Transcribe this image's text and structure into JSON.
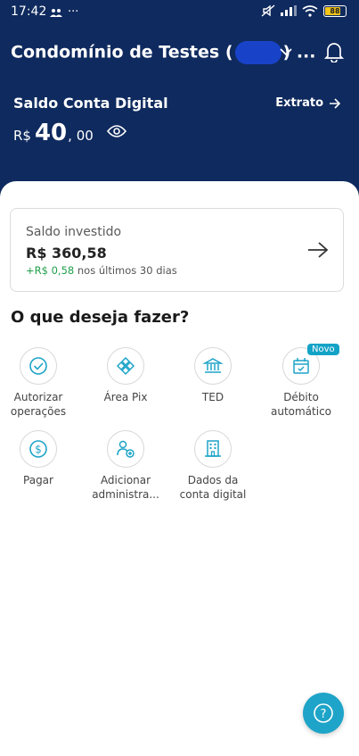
{
  "status_bar": {
    "time": "17:42",
    "dots": "···",
    "battery": "88"
  },
  "header": {
    "condo_title_part1": "Condomínio de Testes (",
    "condo_title_part2": ") ...",
    "saldo_label": "Saldo Conta Digital",
    "extrato_label": "Extrato",
    "currency": "R$",
    "saldo_int": "40",
    "saldo_dec": ", 00"
  },
  "investment": {
    "label": "Saldo investido",
    "value": "R$ 360,58",
    "gain_value": "+R$ 0,58",
    "gain_text": "nos últimos 30 dias"
  },
  "section_title": "O que deseja fazer?",
  "actions": [
    {
      "label_line1": "Autorizar",
      "label_line2": "operações",
      "icon": "check-circle-icon"
    },
    {
      "label_line1": "Área Pix",
      "label_line2": "",
      "icon": "pix-icon"
    },
    {
      "label_line1": "TED",
      "label_line2": "",
      "icon": "bank-icon"
    },
    {
      "label_line1": "Débito",
      "label_line2": "automático",
      "icon": "calendar-check-icon",
      "badge": "Novo"
    },
    {
      "label_line1": "Pagar",
      "label_line2": "",
      "icon": "dollar-circle-icon"
    },
    {
      "label_line1": "Adicionar",
      "label_line2": "administra...",
      "icon": "add-user-icon"
    },
    {
      "label_line1": "Dados da",
      "label_line2": "conta digital",
      "icon": "building-icon"
    }
  ],
  "help_icon": "question-icon",
  "colors": {
    "header_bg": "#0f2a5e",
    "accent": "#1ea4c8",
    "gain": "#1e9e4a"
  }
}
